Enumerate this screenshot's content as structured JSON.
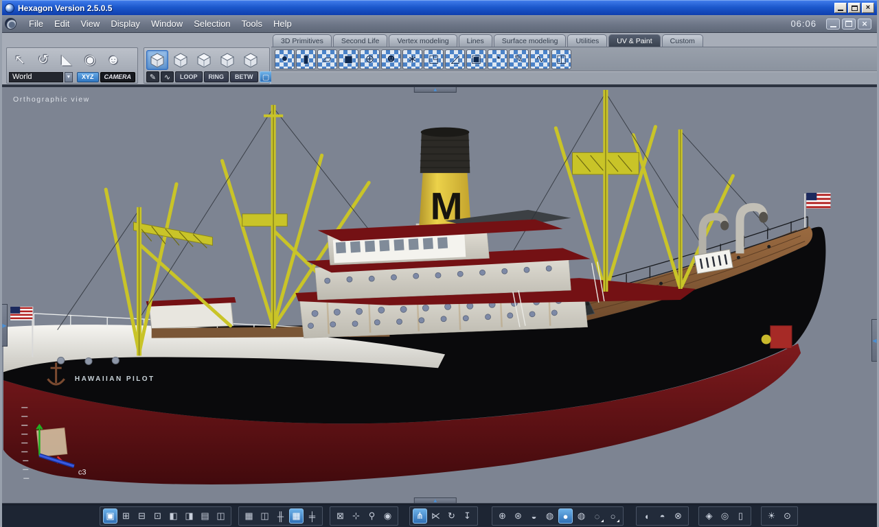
{
  "window": {
    "title": "Hexagon Version 2.5.0.5",
    "time": "06:06"
  },
  "menu": {
    "items": [
      "File",
      "Edit",
      "View",
      "Display",
      "Window",
      "Selection",
      "Tools",
      "Help"
    ]
  },
  "tabs": [
    {
      "name": "tab-3d-primitives",
      "label": "3D Primitives"
    },
    {
      "name": "tab-second-life",
      "label": "Second Life"
    },
    {
      "name": "tab-vertex-modeling",
      "label": "Vertex modeling"
    },
    {
      "name": "tab-lines",
      "label": "Lines"
    },
    {
      "name": "tab-surface-modeling",
      "label": "Surface modeling"
    },
    {
      "name": "tab-utilities",
      "label": "Utilities"
    },
    {
      "name": "tab-uv-paint",
      "label": "UV & Paint",
      "active": true
    },
    {
      "name": "tab-custom",
      "label": "Custom"
    }
  ],
  "tools": {
    "transform_icons": [
      {
        "name": "move-tool-icon",
        "glyph": "↖"
      },
      {
        "name": "rotate-tool-icon",
        "glyph": "↺"
      },
      {
        "name": "scale-tool-icon",
        "glyph": "◣"
      },
      {
        "name": "universal-transform-icon",
        "glyph": "◉"
      },
      {
        "name": "ghost-mode-icon",
        "glyph": "☻"
      }
    ],
    "coords": {
      "world_value": "World",
      "xyz_label": "XYZ",
      "camera_label": "CAMERA"
    },
    "selection_modes": [
      {
        "name": "select-object-mode-icon",
        "active": true
      },
      {
        "name": "select-points-mode-icon"
      },
      {
        "name": "select-edges-mode-icon"
      },
      {
        "name": "select-faces-mode-icon"
      },
      {
        "name": "select-multi-mode-icon"
      }
    ],
    "selection_paint": [
      {
        "name": "paint-select-icon",
        "glyph": "✎"
      },
      {
        "name": "soft-select-icon",
        "glyph": "∿"
      }
    ],
    "loop_label": "LOOP",
    "ring_label": "RING",
    "betw_label": "BETW",
    "marquee": [
      {
        "name": "rectangle-marquee-icon",
        "glyph": "▢",
        "active": true
      },
      {
        "name": "ellipse-marquee-icon",
        "glyph": "◯"
      }
    ],
    "uv_paint_icons": [
      {
        "name": "uv-sphere-projection-icon",
        "glyph": "●"
      },
      {
        "name": "uv-cylinder-projection-icon",
        "glyph": "▮"
      },
      {
        "name": "uv-planar-projection-icon",
        "glyph": "▱"
      },
      {
        "name": "uv-box-projection-icon",
        "glyph": "◼"
      },
      {
        "name": "uv-spherical-mapping-icon",
        "glyph": "⊕"
      },
      {
        "name": "uv-unwrap-head-icon",
        "glyph": "☻"
      },
      {
        "name": "uv-unfold-icon",
        "glyph": "∗"
      },
      {
        "name": "uv-flip-plane-icon",
        "glyph": "◳"
      },
      {
        "name": "uv-pin-icon",
        "glyph": "◿"
      },
      {
        "name": "uv-relax-icon",
        "glyph": "▣"
      },
      {
        "name": "uv-rotate-icon",
        "glyph": "◔"
      },
      {
        "name": "paint-brush-icon",
        "glyph": "✎"
      },
      {
        "name": "paint-airbrush-icon",
        "glyph": "∿"
      },
      {
        "name": "uv-editor-icon",
        "glyph": "◫"
      }
    ]
  },
  "viewport": {
    "label": "Orthographic view",
    "ship_name": "HAWAIIAN PILOT",
    "funnel_letter": "M",
    "gizmo_label": "c3"
  },
  "bottom": {
    "layouts": [
      {
        "name": "layout-single-icon",
        "glyph": "▣",
        "active": true
      },
      {
        "name": "layout-quad-icon",
        "glyph": "⊞"
      },
      {
        "name": "layout-three-bottom-icon",
        "glyph": "⊟"
      },
      {
        "name": "layout-three-top-icon",
        "glyph": "⊡"
      },
      {
        "name": "layout-split-left-icon",
        "glyph": "◧"
      },
      {
        "name": "layout-split-right-icon",
        "glyph": "◨"
      },
      {
        "name": "layout-two-rows-icon",
        "glyph": "▤"
      },
      {
        "name": "layout-two-columns-icon",
        "glyph": "◫"
      }
    ],
    "snap": [
      {
        "name": "grid-magnet-icon",
        "glyph": "▦"
      },
      {
        "name": "object-snap-icon",
        "glyph": "◫"
      },
      {
        "name": "grid-xz-plane-icon",
        "glyph": "╫"
      },
      {
        "name": "grid-xy-plane-icon",
        "glyph": "▦",
        "active": true
      },
      {
        "name": "grid-yz-plane-icon",
        "glyph": "╪"
      }
    ],
    "view": [
      {
        "name": "fit-view-icon",
        "glyph": "⊠"
      },
      {
        "name": "pan-view-icon",
        "glyph": "⊹"
      },
      {
        "name": "zoom-view-icon",
        "glyph": "⚲"
      },
      {
        "name": "look-view-icon",
        "glyph": "◉"
      }
    ],
    "manipulators": [
      {
        "name": "universal-manipulator-icon",
        "glyph": "⋔",
        "active": true
      },
      {
        "name": "translate-manipulator-icon",
        "glyph": "⋉"
      },
      {
        "name": "rotate-manipulator-icon",
        "glyph": "↻"
      },
      {
        "name": "drop-tool-icon",
        "glyph": "↧"
      }
    ],
    "shading": [
      {
        "name": "wireframe-display-icon",
        "glyph": "⊕"
      },
      {
        "name": "hiddenline-display-icon",
        "glyph": "⊛"
      },
      {
        "name": "flat-display-icon",
        "glyph": "◒"
      },
      {
        "name": "wire-shaded-display-icon",
        "glyph": "◍"
      },
      {
        "name": "smooth-display-icon",
        "glyph": "●",
        "active": true
      },
      {
        "name": "textured-display-icon",
        "glyph": "◍"
      },
      {
        "name": "material-display-icon",
        "glyph": "◌",
        "flyout": true
      },
      {
        "name": "lighting-display-icon",
        "glyph": "○",
        "flyout": true
      }
    ],
    "culling": [
      {
        "name": "backface-culling-icon",
        "glyph": "◖"
      },
      {
        "name": "double-sided-icon",
        "glyph": "◓"
      },
      {
        "name": "symmetry-icon",
        "glyph": "⊗"
      }
    ],
    "display": [
      {
        "name": "wireframe-object-icon",
        "glyph": "◈"
      },
      {
        "name": "cylinder-object-icon",
        "glyph": "◎"
      },
      {
        "name": "uv-panels-icon",
        "glyph": "▯"
      }
    ],
    "render": [
      {
        "name": "render-preview-icon",
        "glyph": "☀"
      },
      {
        "name": "screenshot-camera-icon",
        "glyph": "⊙"
      }
    ]
  },
  "colors": {
    "accent": "#3f8fd6",
    "titlebar_blue": "#1c58cc",
    "viewport_bg": "#7d8492",
    "hull_black": "#0a0a0c",
    "hull_red": "#6b1316",
    "mast_yellow": "#c9c428",
    "deck_maroon": "#741114",
    "superstructure_white": "#d8d5ca",
    "funnel_yellow": "#e3c93e"
  }
}
